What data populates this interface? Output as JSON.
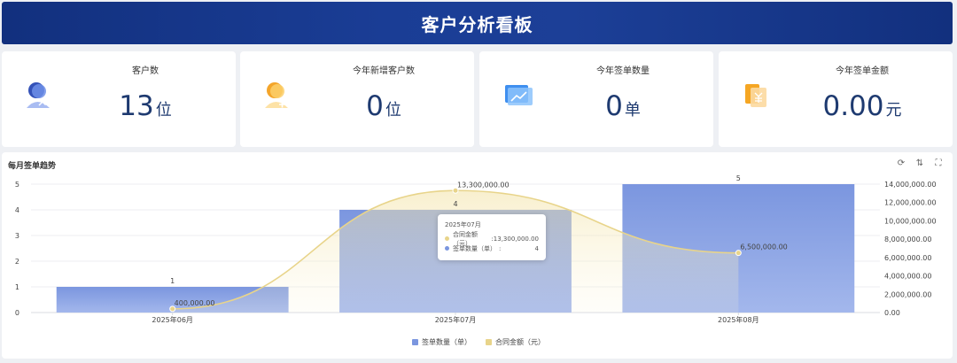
{
  "header": {
    "title": "客户分析看板"
  },
  "cards": [
    {
      "label": "客户数",
      "value": "13",
      "unit": "位",
      "icon": "customer-icon"
    },
    {
      "label": "今年新增客户数",
      "value": "0",
      "unit": "位",
      "icon": "new-customer-icon"
    },
    {
      "label": "今年签单数量",
      "value": "0",
      "unit": "单",
      "icon": "signed-orders-icon"
    },
    {
      "label": "今年签单金额",
      "value": "0.00",
      "unit": "元",
      "icon": "signed-amount-icon"
    }
  ],
  "chart": {
    "title": "每月签单趋势",
    "tools": {
      "refresh": "⟳",
      "sort": "⇅",
      "fullscreen": "⛶"
    }
  },
  "chart_data": {
    "type": "bar",
    "categories": [
      "2025年06月",
      "2025年07月",
      "2025年08月"
    ],
    "series": [
      {
        "name": "签单数量（单）",
        "type": "bar",
        "axis": "left",
        "values": [
          1,
          4,
          5
        ],
        "labels": [
          "1",
          "4",
          "5"
        ],
        "color": "#7b96df"
      },
      {
        "name": "合同金额（元）",
        "type": "line",
        "axis": "right",
        "values": [
          400000,
          13300000,
          6500000
        ],
        "labels": [
          "400,000.00",
          "13,300,000.00",
          "6,500,000.00"
        ],
        "color": "#e8d48a"
      }
    ],
    "y_left": {
      "ticks": [
        "0",
        "1",
        "2",
        "3",
        "4",
        "5"
      ],
      "ylim": [
        0,
        5
      ]
    },
    "y_right": {
      "ticks": [
        "0.00",
        "2,000,000.00",
        "4,000,000.00",
        "6,000,000.00",
        "8,000,000.00",
        "10,000,000.00",
        "12,000,000.00",
        "14,000,000.00"
      ],
      "ylim": [
        0,
        14000000
      ]
    },
    "grid": true,
    "legend": "bottom-center"
  },
  "tooltip": {
    "title": "2025年07月",
    "rows": [
      {
        "label": "合同金额（元）",
        "value": ":13,300,000.00",
        "color": "#e8d48a"
      },
      {
        "label": "签单数量（单）",
        "value": "4",
        "sep": ":",
        "color": "#7b96df"
      }
    ]
  },
  "legend": {
    "items": [
      {
        "label": "签单数量（单）",
        "color": "#7b96df"
      },
      {
        "label": "合同金额（元）",
        "color": "#e8d48a"
      }
    ]
  }
}
